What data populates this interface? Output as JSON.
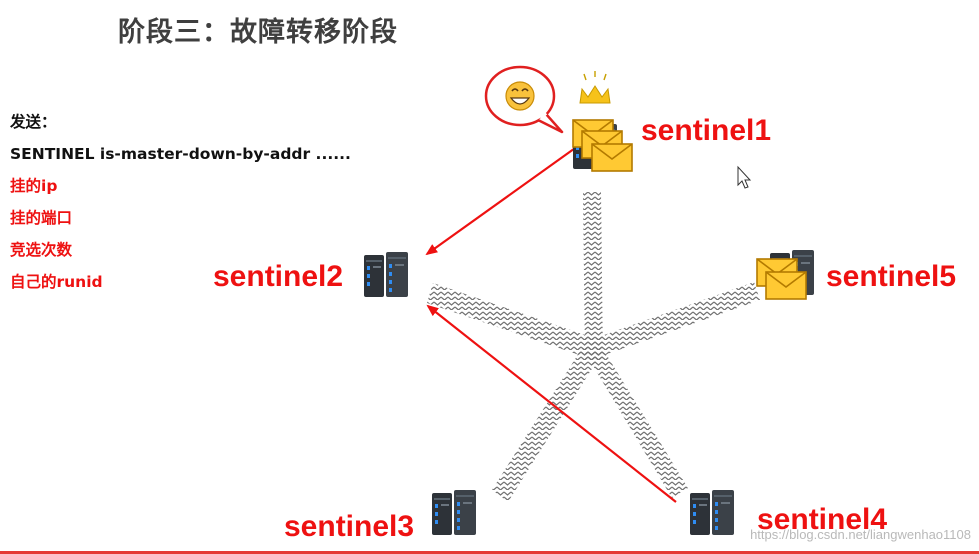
{
  "title": "阶段三：故障转移阶段",
  "left_panel": {
    "lines": [
      {
        "text": "发送：",
        "color": "#111111"
      },
      {
        "text": "SENTINEL is-master-down-by-addr ......",
        "color": "#111111"
      },
      {
        "text": "挂的ip",
        "color": "#ee1111"
      },
      {
        "text": "挂的端口",
        "color": "#ee1111"
      },
      {
        "text": "竞选次数",
        "color": "#ee1111"
      },
      {
        "text": "自己的runid",
        "color": "#ee1111"
      }
    ]
  },
  "nodes": {
    "sentinel1": "sentinel1",
    "sentinel2": "sentinel2",
    "sentinel3": "sentinel3",
    "sentinel4": "sentinel4",
    "sentinel5": "sentinel5"
  },
  "watermark": "https://blog.csdn.net/liangwenhao1108",
  "colors": {
    "accent_red": "#ee1111",
    "server_dark": "#2d3238",
    "server_led": "#2f8df3",
    "envelope_fill": "#ffc933",
    "crown": "#f6c21a"
  },
  "icons": [
    "server-icon",
    "envelope-icon",
    "crown-icon",
    "smiley-icon",
    "speech-bubble-icon",
    "mouse-cursor-icon"
  ]
}
